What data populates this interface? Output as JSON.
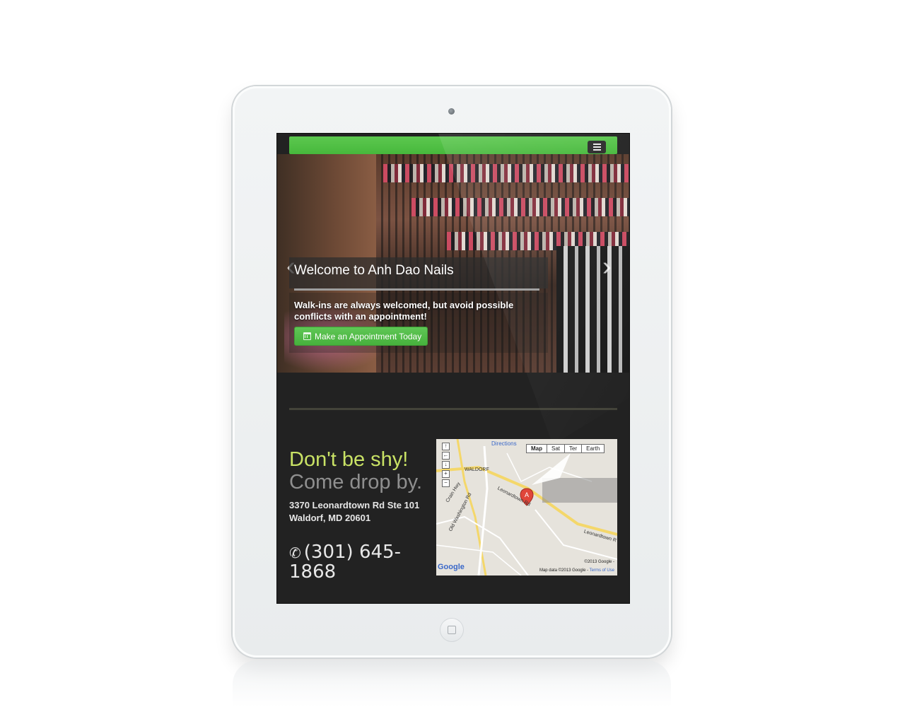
{
  "site": {
    "menu_icon": "hamburger-icon"
  },
  "hero": {
    "title": "Welcome to Anh Dao Nails",
    "subtitle": "Walk-ins are always welcomed, but avoid possible conflicts with an appointment!",
    "cta_label": "Make an Appointment Today",
    "cta_icon": "calendar-icon",
    "prev_arrow": "‹",
    "next_arrow": "›"
  },
  "contact": {
    "heading_1": "Don't be shy!",
    "heading_2": "Come drop by.",
    "address_line1": "3370 Leonardtown Rd Ste 101",
    "address_line2": "Waldorf, MD 20601",
    "phone_icon": "phone-icon",
    "phone": "(301) 645-1868"
  },
  "map": {
    "link_directions": "Directions",
    "types": [
      "Map",
      "Sat",
      "Ter",
      "Earth"
    ],
    "active_type": "Map",
    "marker_label": "A",
    "place_label": "WALDORF",
    "road_label_1": "Leonardtown Rd",
    "road_label_2": "Old Washington Rd",
    "road_label_3": "Crain Hwy",
    "road_label_4": "Leonardtown R",
    "copyright": "©2013 Google -",
    "data_notice": "Map data ©2013 Google -",
    "terms": "Terms of Use",
    "logo": "Google"
  },
  "colors": {
    "navbar_green": "#4cbb41",
    "heading_yellow": "#c9e265",
    "heading_gray": "#8f8f8f",
    "screen_bg": "#222222"
  }
}
